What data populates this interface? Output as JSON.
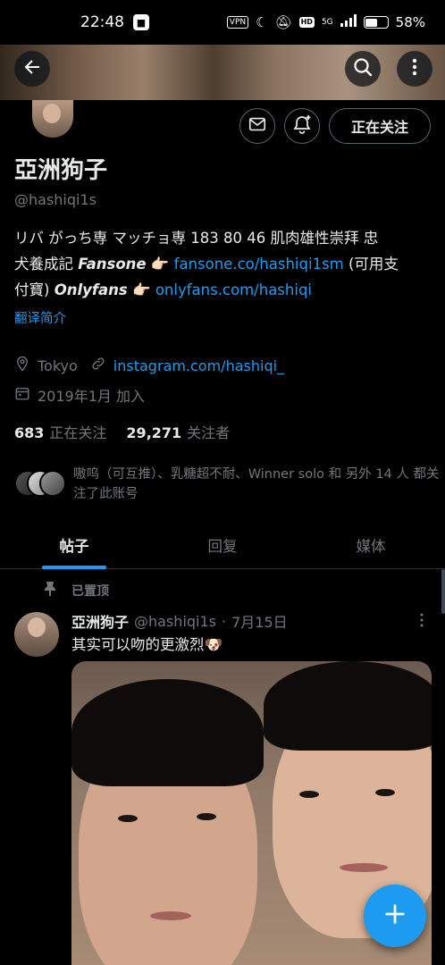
{
  "status_bar": {
    "time": "22:48",
    "vpn": "VPN",
    "hd": "HD",
    "signal": "5G",
    "battery": "58%",
    "battery_level": 0.58
  },
  "profile": {
    "display_name": "亞洲狗子",
    "handle": "@hashiqi1s",
    "follow_button_label": "正在关注",
    "bio": {
      "line1": "リバ がっち専 マッチョ専 183 80 46  肌肉雄性崇拜 忠",
      "line2_prefix": "犬養成記 ",
      "fansone_label": "Fansone",
      "pointer1": " 👉🏻 ",
      "fansone_link": "fansone.co/hashiqi1sm",
      "line2_suffix": " (可用支",
      "line3_prefix": "付寶) ",
      "onlyfans_label": "Onlyfans",
      "pointer2": " 👉🏻 ",
      "onlyfans_link": "onlyfans.com/hashiqi"
    },
    "translate_label": "翻译简介",
    "location": "Tokyo",
    "website": "instagram.com/hashiqi_",
    "joined": "2019年1月 加入",
    "following_count": "683",
    "following_label": "正在关注",
    "followers_count": "29,271",
    "followers_label": "关注者",
    "followed_by_text": "嗷呜（可互推）、乳糖超不耐、Winner solo 和 另外 14 人 都关注了此账号"
  },
  "tabs": [
    {
      "label": "帖子",
      "active": true
    },
    {
      "label": "回复",
      "active": false
    },
    {
      "label": "媒体",
      "active": false
    }
  ],
  "post": {
    "pinned_label": "已置顶",
    "author_name": "亞洲狗子",
    "author_handle": "@hashiqi1s",
    "separator": "·",
    "date": "7月15日",
    "text": "其实可以吻的更激烈🐶"
  },
  "colors": {
    "accent": "#1d9bf0",
    "background": "#000000",
    "text_primary": "#e7e9ea",
    "text_secondary": "#71767b",
    "border": "#536471"
  },
  "icons": {
    "back": "arrow-left-icon",
    "search": "search-icon",
    "more": "more-vertical-icon",
    "message": "envelope-icon",
    "notify": "bell-plus-icon",
    "location": "location-pin-icon",
    "link": "link-icon",
    "calendar": "calendar-icon",
    "pin": "pin-icon",
    "compose": "plus-icon"
  }
}
